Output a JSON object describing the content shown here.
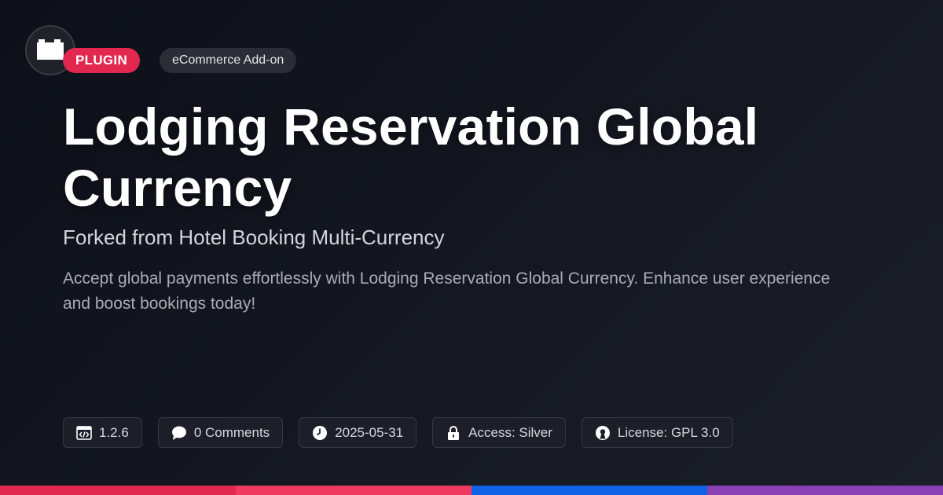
{
  "badges": {
    "type": "PLUGIN",
    "category": "eCommerce Add-on"
  },
  "title": "Lodging Reservation Global Currency",
  "subtitle": "Forked from Hotel Booking Multi-Currency",
  "description": "Accept global payments effortlessly with Lodging Reservation Global Currency. Enhance user experience and boost bookings today!",
  "meta": {
    "version": "1.2.6",
    "comments": "0 Comments",
    "date": "2025-05-31",
    "access": "Access: Silver",
    "license": "License: GPL 3.0"
  },
  "icons": {
    "logo": "plugin-block-icon",
    "version": "code-window-icon",
    "comments": "speech-bubble-icon",
    "date": "clock-icon",
    "access": "lock-icon",
    "license": "open-source-icon"
  },
  "colors": {
    "plugin_badge": "#e3284f",
    "bar": [
      "#e3284f",
      "#f03a5f",
      "#0f62e6",
      "#8a3fb3"
    ]
  }
}
